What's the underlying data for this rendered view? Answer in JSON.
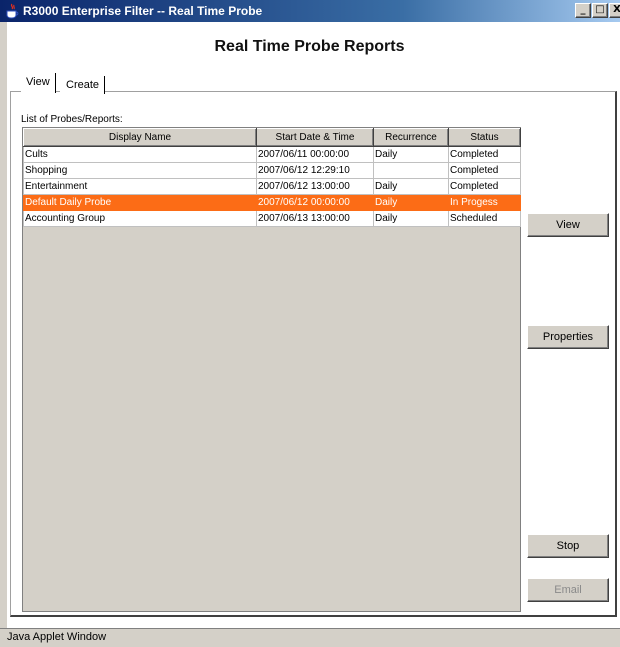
{
  "window": {
    "title": "R3000 Enterprise Filter -- Real Time Probe",
    "icon": "java-cup-icon"
  },
  "window_controls": {
    "minimize": "_",
    "maximize": "□",
    "close": "X"
  },
  "page": {
    "heading": "Real Time Probe Reports"
  },
  "tabs": [
    {
      "label": "View",
      "selected": true
    },
    {
      "label": "Create",
      "selected": false
    }
  ],
  "list": {
    "label": "List of Probes/Reports:",
    "columns": [
      "Display Name",
      "Start Date & Time",
      "Recurrence",
      "Status"
    ],
    "rows": [
      {
        "name": "Cults",
        "start": "2007/06/11 00:00:00",
        "recurrence": "Daily",
        "status": "Completed"
      },
      {
        "name": "Shopping",
        "start": "2007/06/12 12:29:10",
        "recurrence": "",
        "status": "Completed"
      },
      {
        "name": "Entertainment",
        "start": "2007/06/12 13:00:00",
        "recurrence": "Daily",
        "status": "Completed"
      },
      {
        "name": "Default Daily Probe",
        "start": "2007/06/12 00:00:00",
        "recurrence": "Daily",
        "status": "In Progess"
      },
      {
        "name": "Accounting Group",
        "start": "2007/06/13 13:00:00",
        "recurrence": "Daily",
        "status": "Scheduled"
      }
    ],
    "selected_row": 3,
    "selection_color": "#fc6c16"
  },
  "buttons": {
    "view": "View",
    "properties": "Properties",
    "stop": "Stop",
    "email": "Email"
  },
  "status_bar": {
    "text": "Java Applet Window"
  }
}
